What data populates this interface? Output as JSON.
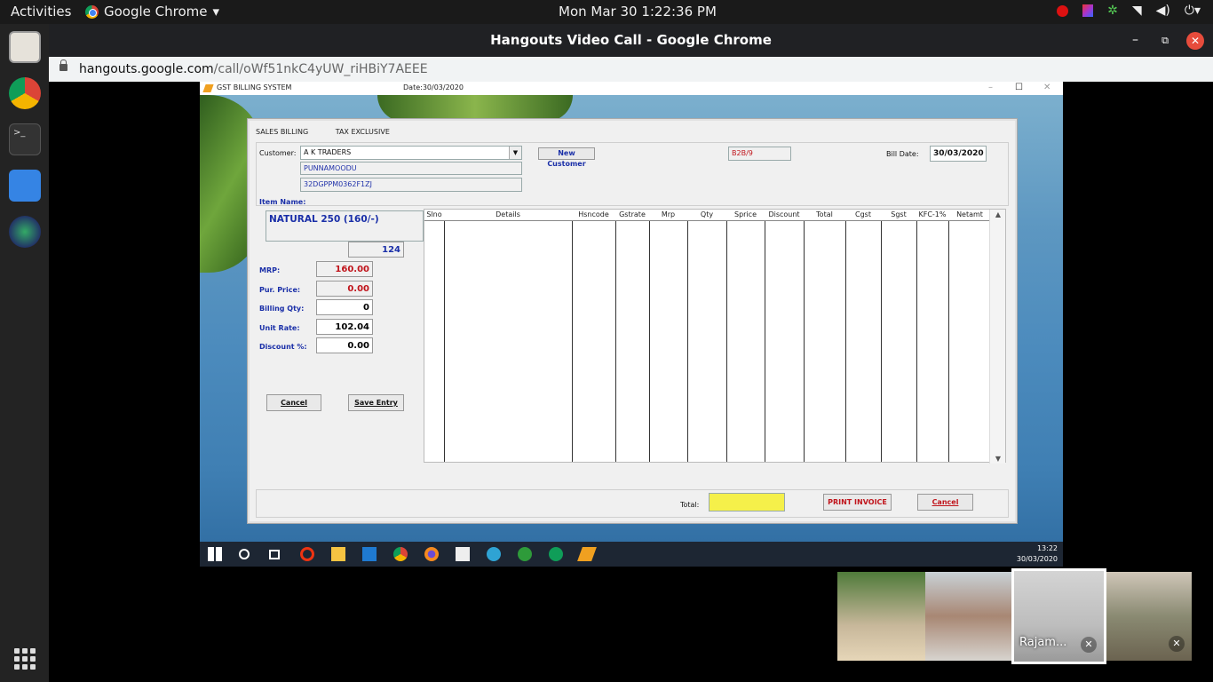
{
  "gnome": {
    "activities": "Activities",
    "app_name": "Google Chrome",
    "app_menu_arrow": "▾",
    "clock": "Mon Mar 30   1:22:36 PM",
    "tray_icons": [
      "record-icon",
      "color-app-icon",
      "network-app-icon",
      "wifi-icon",
      "volume-icon",
      "power-icon"
    ]
  },
  "dock": {
    "items": [
      "files-icon",
      "chrome-icon",
      "terminal-icon",
      "tasks-icon",
      "globe-icon"
    ],
    "apps_grid": "show-applications-icon"
  },
  "chrome": {
    "title": "Hangouts Video Call - Google Chrome",
    "url_domain": "hangouts.google.com",
    "url_path": "/call/oWf51nkC4yUW_riHBiY7AEEE",
    "minimize": "–",
    "maximize": "⧉",
    "close": "✕"
  },
  "app": {
    "title": "GST BILLING SYSTEM",
    "date": "Date:30/03/2020",
    "min": "–",
    "max": "☐",
    "close": "✕",
    "tabs": [
      "SALES BILLING",
      "TAX EXCLUSIVE"
    ],
    "customer_label": "Customer:",
    "customer_name": "A K TRADERS",
    "customer_place": "PUNNAMOODU",
    "customer_gstin": "32DGPPM0362F1ZJ",
    "new_customer": "New Customer",
    "bill_code": "B2B/9",
    "bill_date_label": "Bill Date:",
    "bill_date": "30/03/2020",
    "item_name_label": "Item Name:",
    "item_name": "NATURAL 250 (160/-)",
    "item_code": "124",
    "mrp_label": "MRP:",
    "mrp": "160.00",
    "pur_price_label": "Pur. Price:",
    "pur_price": "0.00",
    "billing_qty_label": "Billing Qty:",
    "billing_qty": "0",
    "unit_rate_label": "Unit Rate:",
    "unit_rate": "102.04",
    "discount_label": "Discount %:",
    "discount": "0.00",
    "cancel_entry": "Cancel",
    "save_entry": "Save Entry",
    "columns": [
      "Slno",
      "Details",
      "Hsncode",
      "Gstrate",
      "Mrp",
      "Qty",
      "Sprice",
      "Discount",
      "Total",
      "Cgst",
      "Sgst",
      "KFC-1%",
      "Netamt"
    ],
    "scroll_up": "▲",
    "scroll_down": "▼",
    "total_label": "Total:",
    "total_value": "",
    "print_invoice": "PRINT INVOICE",
    "cancel": "Cancel"
  },
  "taskbar": {
    "icons": [
      "windows-start-icon",
      "search-circle-icon",
      "task-view-icon",
      "opera-icon",
      "file-explorer-icon",
      "mail-icon",
      "chrome-icon",
      "firefox-icon",
      "notes-icon",
      "cloud-icon",
      "xbox-icon",
      "hangouts-icon",
      "billing-app-icon"
    ],
    "time": "13:22",
    "date": "30/03/2020"
  },
  "participants": [
    {
      "name": "",
      "muted": false
    },
    {
      "name": "",
      "muted": false
    },
    {
      "name": "Rajam...",
      "muted": true
    },
    {
      "name": "",
      "muted": true
    }
  ],
  "colors": {
    "accent_blue": "#1a2fa8",
    "red_value": "#c0141b",
    "total_yellow": "#f5f04a"
  }
}
